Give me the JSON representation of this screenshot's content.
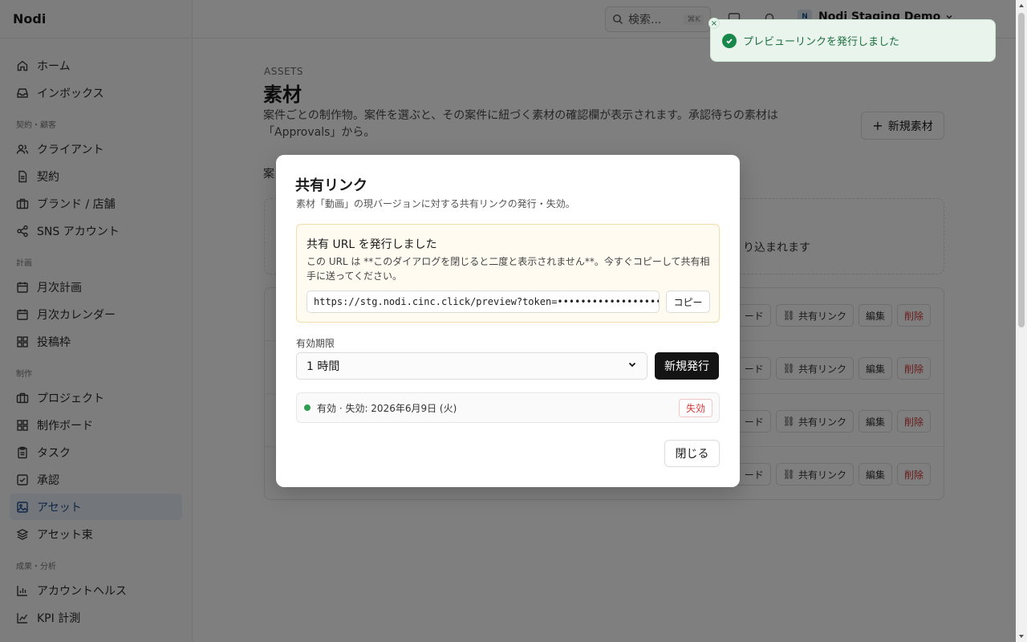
{
  "app": {
    "name": "Nodi"
  },
  "sidebar": {
    "groups": [
      {
        "label": "",
        "items": [
          {
            "label": "ホーム",
            "icon": "home-icon"
          },
          {
            "label": "インボックス",
            "icon": "inbox-icon"
          }
        ]
      },
      {
        "label": "契約・顧客",
        "items": [
          {
            "label": "クライアント",
            "icon": "users-icon"
          },
          {
            "label": "契約",
            "icon": "file-icon"
          },
          {
            "label": "ブランド / 店舗",
            "icon": "briefcase-icon"
          },
          {
            "label": "SNS アカウント",
            "icon": "share-icon"
          }
        ]
      },
      {
        "label": "計画",
        "items": [
          {
            "label": "月次計画",
            "icon": "calendar-icon"
          },
          {
            "label": "月次カレンダー",
            "icon": "calendar-icon"
          },
          {
            "label": "投稿枠",
            "icon": "grid-icon"
          }
        ]
      },
      {
        "label": "制作",
        "items": [
          {
            "label": "プロジェクト",
            "icon": "briefcase-icon"
          },
          {
            "label": "制作ボード",
            "icon": "grid-icon"
          },
          {
            "label": "タスク",
            "icon": "clipboard-icon"
          },
          {
            "label": "承認",
            "icon": "check-square-icon"
          },
          {
            "label": "アセット",
            "icon": "image-icon",
            "active": true
          },
          {
            "label": "アセット束",
            "icon": "layers-icon"
          }
        ]
      },
      {
        "label": "成果・分析",
        "items": [
          {
            "label": "アカウントヘルス",
            "icon": "bar-chart-icon"
          },
          {
            "label": "KPI 計測",
            "icon": "line-chart-icon"
          }
        ]
      }
    ]
  },
  "header": {
    "search_label": "検索...",
    "search_shortcut": "⌘K",
    "org_badge": "N",
    "org_name": "Nodi Staging Demo"
  },
  "page": {
    "eyebrow": "ASSETS",
    "title": "素材",
    "description": "案件ごとの制作物。案件を選ぶと、その案件に紐づく素材の確認欄が表示されます。承認待ちの素材は「Approvals」から。",
    "new_button": "新規素材",
    "section_label_partial": "案",
    "dropzone_text_partial": "り込まれます",
    "row_actions": {
      "code_partial": "ード",
      "share": "共有リンク",
      "edit": "編集",
      "delete": "削除"
    }
  },
  "toast": {
    "message": "プレビューリンクを発行しました",
    "close": "×"
  },
  "dialog": {
    "title": "共有リンク",
    "subtitle": "素材「動画」の現バージョンに対する共有リンクの発行・失効。",
    "notice_title": "共有 URL を発行しました",
    "notice_body": "この URL は **このダイアログを閉じると二度と表示されません**。今すぐコピーして共有相手に送ってください。",
    "url_value": "https://stg.nodi.cinc.click/preview?token=••••••••••••••••••",
    "copy_button": "コピー",
    "expiry_label": "有効期限",
    "expiry_selected": "1 時間",
    "issue_button": "新規発行",
    "link_status": "有効 · 失効: 2026年6月9日 (火)",
    "revoke_button": "失効",
    "close_button": "閉じる"
  },
  "colors": {
    "accent": "#1f4f8f",
    "success": "#17874a",
    "danger": "#d03838",
    "primary_button": "#141414"
  }
}
